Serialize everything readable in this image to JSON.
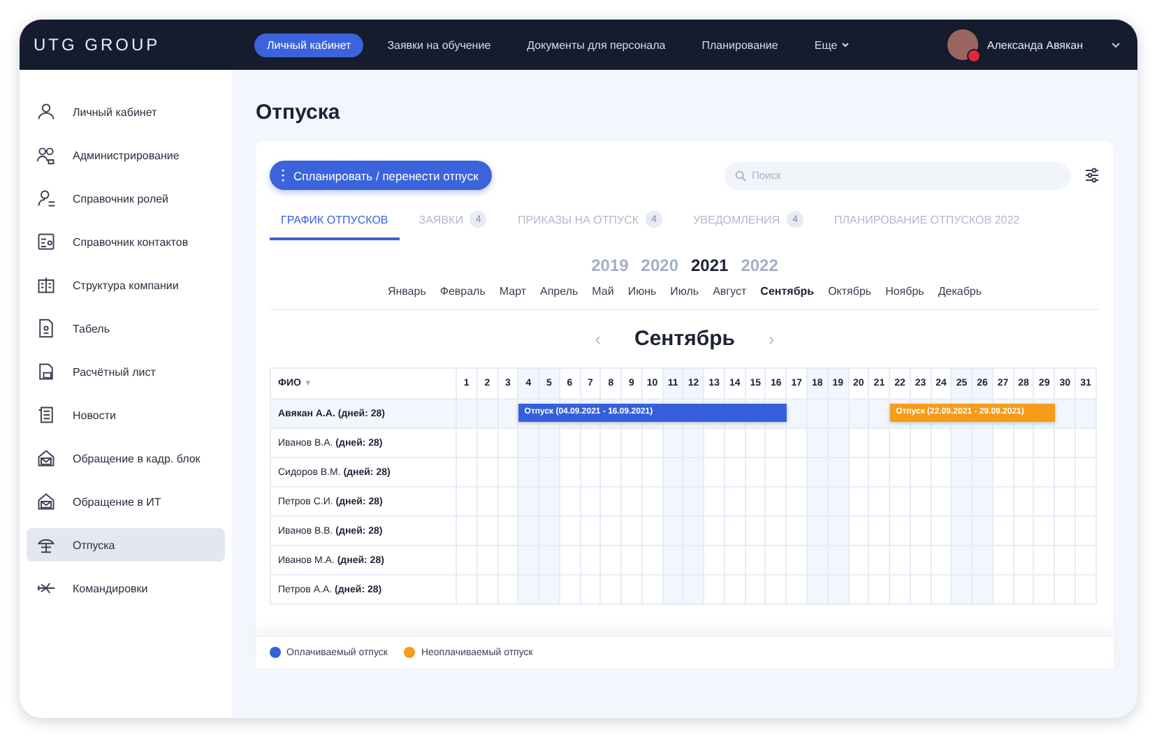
{
  "topbar": {
    "logo": "UTG GROUP",
    "nav": [
      {
        "label": "Личный кабинет",
        "selected": true
      },
      {
        "label": "Заявки на обучение",
        "selected": false
      },
      {
        "label": "Документы для персонала",
        "selected": false
      },
      {
        "label": "Планирование",
        "selected": false
      },
      {
        "label": "Еще",
        "selected": false,
        "dropdown": true
      }
    ],
    "user": {
      "name": "Александа Авякан",
      "notification": true
    }
  },
  "sidebar": {
    "items": [
      {
        "label": "Личный кабинет",
        "selected": false
      },
      {
        "label": "Администрирование",
        "selected": false
      },
      {
        "label": "Справочник ролей",
        "selected": false
      },
      {
        "label": "Справочник контактов",
        "selected": false
      },
      {
        "label": "Структура компании",
        "selected": false
      },
      {
        "label": "Табель",
        "selected": false
      },
      {
        "label": "Расчётный лист",
        "selected": false
      },
      {
        "label": "Новости",
        "selected": false
      },
      {
        "label": "Обращение в кадр. блок",
        "selected": false
      },
      {
        "label": "Обращение в ИТ",
        "selected": false
      },
      {
        "label": "Отпуска",
        "selected": true
      },
      {
        "label": "Командировки",
        "selected": false
      }
    ]
  },
  "page": {
    "title": "Отпуска",
    "action_button": "Спланировать / перенести отпуск",
    "search": {
      "placeholder": "Поиск"
    },
    "tabs": [
      {
        "label": "ГРАФИК ОТПУСКОВ",
        "selected": true
      },
      {
        "label": "ЗАЯВКИ",
        "badge": "4",
        "selected": false
      },
      {
        "label": "ПРИКАЗЫ НА ОТПУСК",
        "badge": "4",
        "selected": false
      },
      {
        "label": "УВЕДОМЛЕНИЯ",
        "badge": "4",
        "selected": false
      },
      {
        "label": "ПЛАНИРОВАНИЕ ОТПУСКОВ 2022",
        "selected": false
      }
    ],
    "years": [
      {
        "label": "2019",
        "selected": false
      },
      {
        "label": "2020",
        "selected": false
      },
      {
        "label": "2021",
        "selected": true
      },
      {
        "label": "2022",
        "selected": false
      }
    ],
    "months": [
      {
        "label": "Январь",
        "selected": false
      },
      {
        "label": "Февраль",
        "selected": false
      },
      {
        "label": "Март",
        "selected": false
      },
      {
        "label": "Апрель",
        "selected": false
      },
      {
        "label": "Май",
        "selected": false
      },
      {
        "label": "Июнь",
        "selected": false
      },
      {
        "label": "Июль",
        "selected": false
      },
      {
        "label": "Август",
        "selected": false
      },
      {
        "label": "Сентябрь",
        "selected": true
      },
      {
        "label": "Октябрь",
        "selected": false
      },
      {
        "label": "Ноябрь",
        "selected": false
      },
      {
        "label": "Декабрь",
        "selected": false
      }
    ],
    "month_nav": {
      "title": "Сентябрь",
      "prev": "‹",
      "next": "›"
    },
    "schedule": {
      "name_column": "ФИО",
      "sort_indicator": "▼",
      "days": [
        {
          "label": "1",
          "weekend": false
        },
        {
          "label": "2",
          "weekend": false
        },
        {
          "label": "3",
          "weekend": false
        },
        {
          "label": "4",
          "weekend": true
        },
        {
          "label": "5",
          "weekend": true
        },
        {
          "label": "6",
          "weekend": false
        },
        {
          "label": "7",
          "weekend": false
        },
        {
          "label": "8",
          "weekend": false
        },
        {
          "label": "9",
          "weekend": false
        },
        {
          "label": "10",
          "weekend": false
        },
        {
          "label": "11",
          "weekend": true
        },
        {
          "label": "12",
          "weekend": true
        },
        {
          "label": "13",
          "weekend": false
        },
        {
          "label": "14",
          "weekend": false
        },
        {
          "label": "15",
          "weekend": false
        },
        {
          "label": "16",
          "weekend": false
        },
        {
          "label": "17",
          "weekend": false
        },
        {
          "label": "18",
          "weekend": true
        },
        {
          "label": "19",
          "weekend": true
        },
        {
          "label": "20",
          "weekend": false
        },
        {
          "label": "21",
          "weekend": false
        },
        {
          "label": "22",
          "weekend": false
        },
        {
          "label": "23",
          "weekend": false
        },
        {
          "label": "24",
          "weekend": false
        },
        {
          "label": "25",
          "weekend": true
        },
        {
          "label": "26",
          "weekend": true
        },
        {
          "label": "27",
          "weekend": false
        },
        {
          "label": "28",
          "weekend": false
        },
        {
          "label": "29",
          "weekend": false
        },
        {
          "label": "30",
          "weekend": false
        },
        {
          "label": "31",
          "weekend": false
        }
      ],
      "rows": [
        {
          "name": "Авякан А.А. (дней: 28)",
          "selected": true,
          "vacations": [
            {
              "label": "Отпуск (04.09.2021 - 16.09.2021)",
              "days": [
                false,
                false,
                false,
                true,
                true,
                true,
                true,
                true,
                true,
                true,
                true,
                true,
                true,
                true,
                true,
                true,
                false,
                false,
                false,
                false,
                false,
                false,
                false,
                false,
                false,
                false,
                false,
                false,
                false,
                false,
                false
              ],
              "color": "#3560dc"
            },
            {
              "label": "Отпуск (22.09.2021 - 29.09.2021)",
              "days": [
                false,
                false,
                false,
                false,
                false,
                false,
                false,
                false,
                false,
                false,
                false,
                false,
                false,
                false,
                false,
                false,
                false,
                false,
                false,
                false,
                false,
                true,
                true,
                true,
                true,
                true,
                true,
                true,
                true,
                false,
                false
              ],
              "color": "#f59c1a"
            }
          ]
        },
        {
          "name": "Иванов В.А. **(дней: 28)**",
          "selected": false
        },
        {
          "name": "Сидоров В.М. **(дней: 28)**",
          "selected": false
        },
        {
          "name": "Петров С.И. **(дней: 28)**",
          "selected": false
        },
        {
          "name": "Иванов В.В. **(дней: 28)**",
          "selected": false
        },
        {
          "name": "Иванов М.А. **(дней: 28)**",
          "selected": false
        },
        {
          "name": "Петров А.А. **(дней: 28)**",
          "selected": false
        }
      ]
    },
    "legend": [
      {
        "label": "Оплачиваемый отпуск",
        "color": "#3560dc"
      },
      {
        "label": "Неоплачиваемый отпуск",
        "color": "#f59c1a"
      }
    ]
  }
}
